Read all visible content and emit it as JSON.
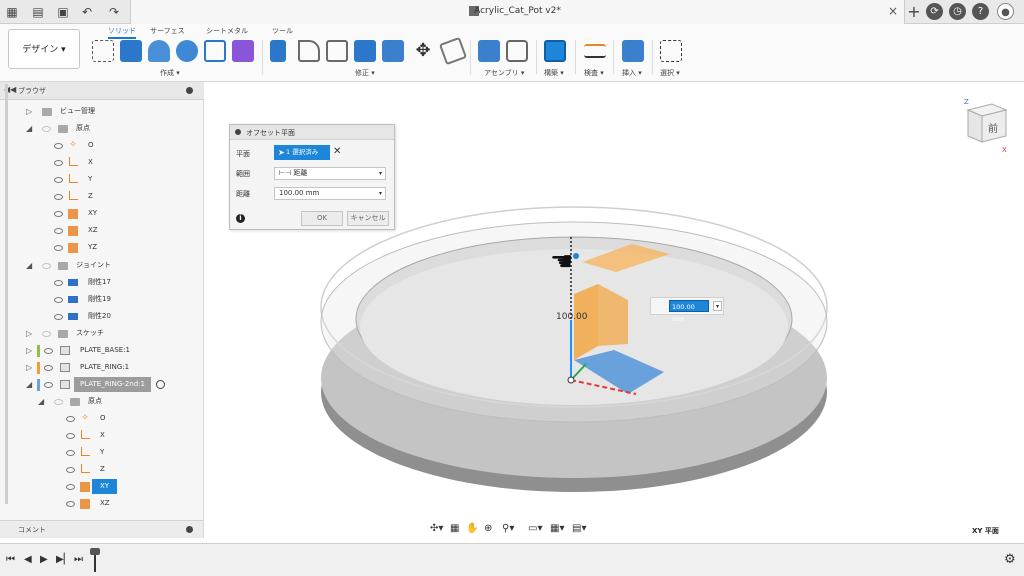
{
  "title_bar": {
    "document_title": "Acrylic_Cat_Pot v2*",
    "close_glyph": "×",
    "left_icons": [
      "grid-icon",
      "file-icon",
      "save-icon",
      "undo-icon",
      "redo-icon"
    ],
    "right_icons": [
      "new-tab-icon",
      "jobs-icon",
      "clock-icon",
      "help-icon",
      "user-icon"
    ]
  },
  "ribbon": {
    "workspace": "デザイン ▾",
    "tabs": [
      "ソリッド",
      "サーフェス",
      "シートメタル",
      "ツール"
    ],
    "active_tab": "ソリッド",
    "groups": [
      "作成 ▾",
      "修正 ▾",
      "アセンブリ ▾",
      "構築 ▾",
      "検査 ▾",
      "挿入 ▾",
      "選択 ▾"
    ]
  },
  "browser": {
    "title": "ブラウザ",
    "items": [
      {
        "label": "ビュー管理"
      },
      {
        "label": "原点"
      },
      {
        "label": "O"
      },
      {
        "label": "X"
      },
      {
        "label": "Y"
      },
      {
        "label": "Z"
      },
      {
        "label": "XY"
      },
      {
        "label": "XZ"
      },
      {
        "label": "YZ"
      },
      {
        "label": "ジョイント"
      },
      {
        "label": "剛性17"
      },
      {
        "label": "剛性19"
      },
      {
        "label": "剛性20"
      },
      {
        "label": "スケッチ"
      },
      {
        "label": "PLATE_BASE:1"
      },
      {
        "label": "PLATE_RING:1"
      },
      {
        "label": "PLATE_RING-2nd:1"
      },
      {
        "label": "原点"
      },
      {
        "label": "O"
      },
      {
        "label": "X"
      },
      {
        "label": "Y"
      },
      {
        "label": "Z"
      },
      {
        "label": "XY"
      },
      {
        "label": "XZ"
      }
    ],
    "colors": {
      "base": "#8bc34a",
      "ring": "#f39c33",
      "ring2": "#6aa2e0"
    }
  },
  "comment": {
    "title": "コメント"
  },
  "dialog": {
    "title": "オフセット平面",
    "plane_label": "平面",
    "plane_value": "1 選択済み",
    "clear_glyph": "✕",
    "extent_label": "範囲",
    "extent_value": "距離",
    "distance_label": "距離",
    "distance_value": "100.00 mm",
    "ok": "OK",
    "cancel": "キャンセル",
    "info_glyph": "i"
  },
  "canvas": {
    "input_value": "100.00 mm",
    "dimension_text": "100.00",
    "status_plane": "XY 平面",
    "viewcube_face": "前"
  }
}
